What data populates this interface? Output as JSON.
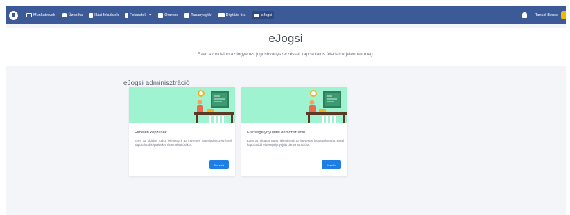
{
  "navbar": {
    "items": [
      {
        "label": "Munkatervek",
        "icon": "monitor-icon"
      },
      {
        "label": "Üzenőfal",
        "icon": "chat-icon"
      },
      {
        "label": "Házi feladatok",
        "icon": "document-icon"
      },
      {
        "label": "Feladatok",
        "icon": "clipboard-icon",
        "has_dropdown": true
      },
      {
        "label": "Órarend",
        "icon": "calendar-icon"
      },
      {
        "label": "Tananyagtár",
        "icon": "book-icon"
      },
      {
        "label": "Digitális óra",
        "icon": "video-icon"
      },
      {
        "label": "eJogsi",
        "icon": "car-icon",
        "active": true
      }
    ],
    "user_name": "Tanuló Bence",
    "colors": {
      "bar": "#3c5a98",
      "active": "#2f4a83",
      "avatar": "#f2b705"
    }
  },
  "header": {
    "title": "eJogsi",
    "subtitle": "Ezen az oldalon az ingyenes jogosítványszerzéssel kapcsolatos feladatok jelennek meg."
  },
  "section": {
    "title": "eJogsi adminisztráció"
  },
  "cards": [
    {
      "title": "Elméleti képzések",
      "text": "Ezen az oldalon tudsz jelentkezni az ingyenes jogosítványszerzéssel kapcsolódó képzésekre és elméleti órákra.",
      "button": "Kezelés"
    },
    {
      "title": "Elsősegélynyújtási demonstráció",
      "text": "Ezen az oldalon tudsz jelentkezni az ingyenes jogosítványszerzéssel kapcsolódó elsősegélynyújtás demonstrációra.",
      "button": "Kezelés"
    }
  ],
  "colors": {
    "card_banner": "#a0f3d0",
    "button": "#1d7fe6"
  }
}
